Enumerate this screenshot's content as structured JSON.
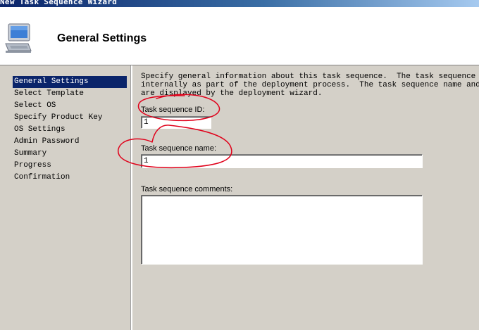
{
  "window": {
    "title": "New Task Sequence Wizard"
  },
  "header": {
    "title": "General Settings",
    "icon": "computer-icon"
  },
  "nav": {
    "items": [
      {
        "label": "General Settings",
        "selected": true
      },
      {
        "label": "Select Template",
        "selected": false
      },
      {
        "label": "Select OS",
        "selected": false
      },
      {
        "label": "Specify Product Key",
        "selected": false
      },
      {
        "label": "OS Settings",
        "selected": false
      },
      {
        "label": "Admin Password",
        "selected": false
      },
      {
        "label": "Summary",
        "selected": false
      },
      {
        "label": "Progress",
        "selected": false
      },
      {
        "label": "Confirmation",
        "selected": false
      }
    ]
  },
  "content": {
    "description": "Specify general information about this task sequence.  The task sequence ID is u\ninternally as part of the deployment process.  The task sequence name and commen\nare displayed by the deployment wizard.",
    "id_label": "Task sequence ID:",
    "id_value": "1",
    "name_label": "Task sequence name:",
    "name_value": "1",
    "comments_label": "Task sequence comments:",
    "comments_value": ""
  },
  "colors": {
    "selection": "#0a246a",
    "annotation": "#e0001a",
    "panel": "#d4d0c8"
  }
}
